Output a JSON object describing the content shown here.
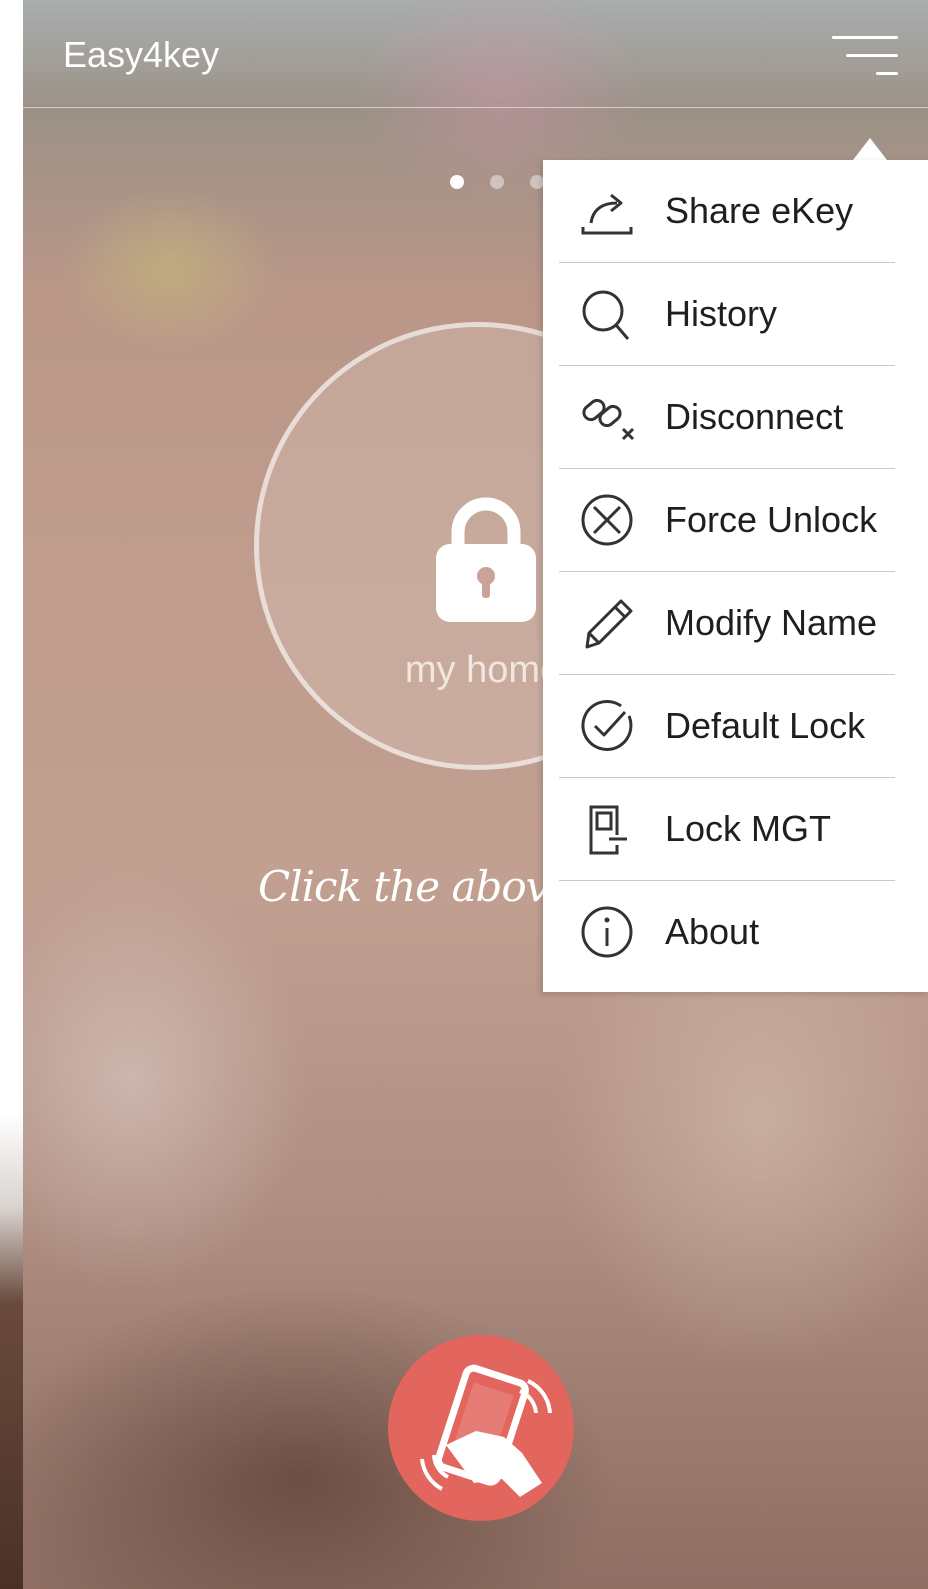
{
  "app": {
    "title": "Easy4key"
  },
  "carousel": {
    "dot_count": 3,
    "active_index": 0
  },
  "lock": {
    "name": "my home"
  },
  "hint": {
    "text": "Click the above icon"
  },
  "menu": {
    "items": [
      {
        "id": "share-ekey",
        "label": "Share eKey",
        "icon": "share-icon"
      },
      {
        "id": "history",
        "label": "History",
        "icon": "search-icon"
      },
      {
        "id": "disconnect",
        "label": "Disconnect",
        "icon": "unlink-icon"
      },
      {
        "id": "force-unlock",
        "label": "Force Unlock",
        "icon": "circle-x-icon"
      },
      {
        "id": "modify-name",
        "label": "Modify Name",
        "icon": "pencil-icon"
      },
      {
        "id": "default-lock",
        "label": "Default Lock",
        "icon": "circle-check-icon"
      },
      {
        "id": "lock-mgt",
        "label": "Lock MGT",
        "icon": "door-lock-icon"
      },
      {
        "id": "about",
        "label": "About",
        "icon": "info-icon"
      }
    ]
  },
  "colors": {
    "accent": "#e2655e",
    "menu_background": "#ffffff",
    "menu_text": "#1f1f1f",
    "divider": "#c9c9c9"
  }
}
